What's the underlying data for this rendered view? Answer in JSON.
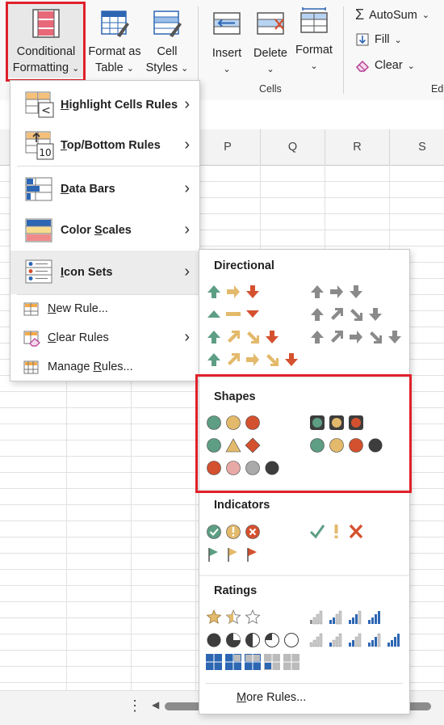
{
  "ribbon": {
    "conditional_formatting": {
      "line1": "Conditional",
      "line2": "Formatting"
    },
    "format_as_table": {
      "line1": "Format as",
      "line2": "Table"
    },
    "cell_styles": {
      "line1": "Cell",
      "line2": "Styles"
    },
    "insert": "Insert",
    "delete": "Delete",
    "format": "Format",
    "cells_group": "Cells",
    "autosum": "AutoSum",
    "fill": "Fill",
    "clear": "Clear",
    "editing_group_partial": "Edi",
    "chevron": "⌄"
  },
  "columns": [
    "P",
    "Q",
    "R",
    "S"
  ],
  "cf_menu": {
    "items": [
      {
        "label": "Highlight Cells Rules",
        "mnemonic": "H",
        "rest": "ighlight Cells Rules"
      },
      {
        "label": "Top/Bottom Rules",
        "mnemonic": "T",
        "rest": "op/Bottom Rules"
      },
      {
        "label": "Data Bars",
        "mnemonic": "D",
        "rest": "ata Bars"
      },
      {
        "label": "Color Scales",
        "pre": "Color ",
        "mnemonic": "S",
        "rest": "cales"
      },
      {
        "label": "Icon Sets",
        "mnemonic": "I",
        "rest": "con Sets"
      }
    ],
    "new_rule": {
      "pre": "",
      "mnemonic": "N",
      "rest": "ew Rule..."
    },
    "clear_rules": {
      "mnemonic": "C",
      "rest": "lear Rules"
    },
    "manage_rules": {
      "pre": "Manage ",
      "mnemonic": "R",
      "rest": "ules..."
    },
    "topbottom_icon_number": "10",
    "highlight_icon_symbol": "<",
    "arrow": "›"
  },
  "icon_sets": {
    "directional": "Directional",
    "shapes": "Shapes",
    "indicators": "Indicators",
    "ratings": "Ratings",
    "more_rules": {
      "mnemonic": "M",
      "rest": "ore Rules..."
    }
  },
  "colors": {
    "green": "#5d9e84",
    "yellow": "#e3b96b",
    "red": "#d4512f",
    "gray": "#8a8a8a",
    "dark": "#3d3d3d",
    "pink": "#e8aaa6",
    "lightgray": "#aaaaaa",
    "blue": "#2d66b3",
    "highlight_red": "#e0212a"
  }
}
